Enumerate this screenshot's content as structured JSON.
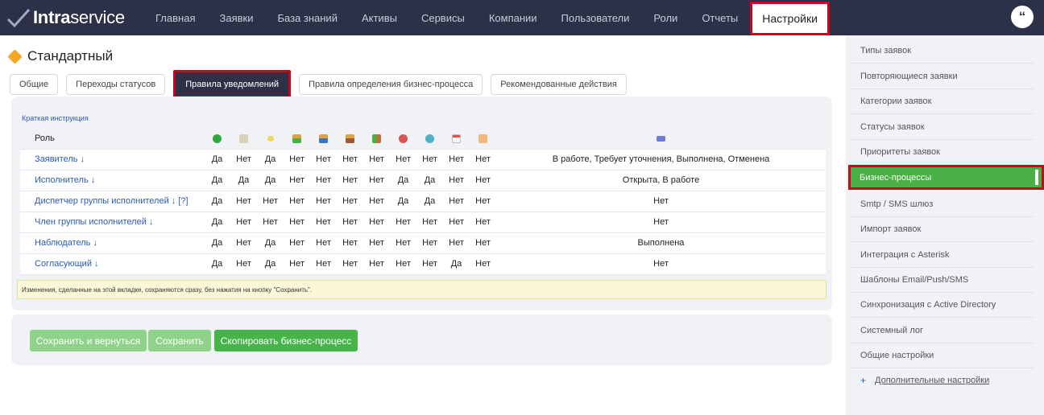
{
  "brand": {
    "bold": "Intra",
    "regular": "service"
  },
  "nav": [
    {
      "label": "Главная"
    },
    {
      "label": "Заявки"
    },
    {
      "label": "База знаний"
    },
    {
      "label": "Активы"
    },
    {
      "label": "Сервисы"
    },
    {
      "label": "Компании"
    },
    {
      "label": "Пользователи"
    },
    {
      "label": "Роли"
    },
    {
      "label": "Отчеты"
    },
    {
      "label": "Настройки"
    }
  ],
  "page": {
    "title": "Стандартный"
  },
  "tabs": [
    {
      "label": "Общие"
    },
    {
      "label": "Переходы статусов"
    },
    {
      "label": "Правила уведомлений"
    },
    {
      "label": "Правила определения бизнес-процесса"
    },
    {
      "label": "Рекомендованные действия"
    }
  ],
  "instruction_link": "Краткая инструкция",
  "table": {
    "role_header": "Роль",
    "icon_columns": [
      "add-icon",
      "edit-icon",
      "comment-icon",
      "person-green-icon",
      "person-blue-icon",
      "person-orange-icon",
      "group-icon",
      "deadline-red-icon",
      "clock-icon",
      "calendar-icon",
      "hand-icon",
      "eraser-icon"
    ],
    "rows": [
      {
        "role": "Заявитель ↓",
        "values": [
          "Да",
          "Нет",
          "Да",
          "Нет",
          "Нет",
          "Нет",
          "Нет",
          "Нет",
          "Нет",
          "Нет",
          "Нет"
        ],
        "statuses": "В работе, Требует уточнения, Выполнена, Отменена"
      },
      {
        "role": "Исполнитель ↓",
        "values": [
          "Да",
          "Да",
          "Да",
          "Нет",
          "Нет",
          "Нет",
          "Нет",
          "Да",
          "Да",
          "Нет",
          "Нет"
        ],
        "statuses": "Открыта, В работе"
      },
      {
        "role": "Диспетчер группы исполнителей ↓ [?]",
        "values": [
          "Да",
          "Нет",
          "Нет",
          "Нет",
          "Нет",
          "Нет",
          "Нет",
          "Да",
          "Да",
          "Нет",
          "Нет"
        ],
        "statuses": "Нет"
      },
      {
        "role": "Член группы исполнителей ↓",
        "values": [
          "Да",
          "Нет",
          "Нет",
          "Нет",
          "Нет",
          "Нет",
          "Нет",
          "Нет",
          "Нет",
          "Нет",
          "Нет"
        ],
        "statuses": "Нет"
      },
      {
        "role": "Наблюдатель ↓",
        "values": [
          "Да",
          "Нет",
          "Да",
          "Нет",
          "Нет",
          "Нет",
          "Нет",
          "Нет",
          "Нет",
          "Нет",
          "Нет"
        ],
        "statuses": "Выполнена"
      },
      {
        "role": "Согласующий ↓",
        "values": [
          "Да",
          "Нет",
          "Да",
          "Нет",
          "Нет",
          "Нет",
          "Нет",
          "Нет",
          "Нет",
          "Да",
          "Нет"
        ],
        "statuses": "Нет"
      }
    ]
  },
  "notice": "Изменения, сделанные на этой вкладке, сохраняются сразу, без нажатия на кнопку \"Сохранить\".",
  "buttons": {
    "save_back": "Сохранить и вернуться",
    "save": "Сохранить",
    "copy": "Скопировать бизнес-процесс"
  },
  "sidebar": {
    "items": [
      {
        "label": "Типы заявок"
      },
      {
        "label": "Повторяющиеся заявки"
      },
      {
        "label": "Категории заявок"
      },
      {
        "label": "Статусы заявок"
      },
      {
        "label": "Приоритеты заявок"
      },
      {
        "label": "Бизнес-процессы"
      },
      {
        "label": "Smtp / SMS шлюз"
      },
      {
        "label": "Импорт заявок"
      },
      {
        "label": "Интеграция с Asterisk"
      },
      {
        "label": "Шаблоны Email/Push/SMS"
      },
      {
        "label": "Синхронизация с Active Directory"
      },
      {
        "label": "Системный лог"
      },
      {
        "label": "Общие настройки"
      }
    ],
    "more": "Дополнительные настройки"
  },
  "colors": {
    "topbar": "#2c3148",
    "accent_green": "#47b44a",
    "highlight_red": "#d0021b",
    "link_blue": "#2b5ab3"
  }
}
